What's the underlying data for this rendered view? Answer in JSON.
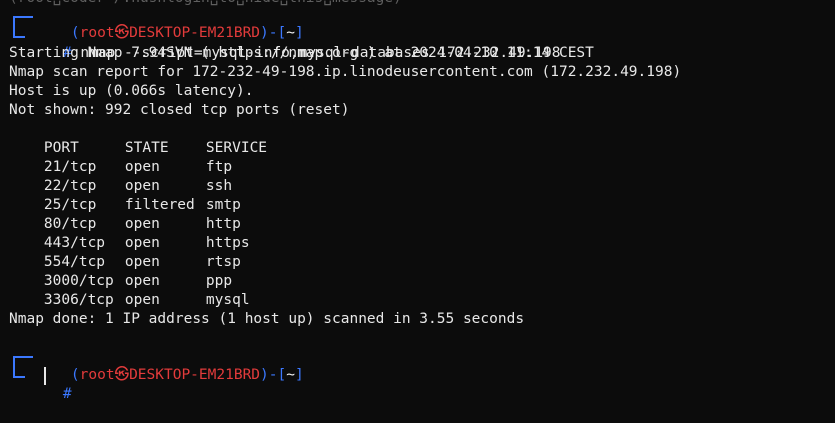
{
  "terminal": {
    "faint_top": "(root␣coder~/.hushlogin␣to␣hide␣this␣message)",
    "prompt1": {
      "open": "(",
      "user": "root",
      "sep": "㉿",
      "host": "DESKTOP-EM21BRD",
      "close": ")-[",
      "dir": "~",
      "end": "]"
    },
    "command": {
      "hash": "#",
      "text": " nmap --script=mysql-info,mysql-databases 172.232.49.198"
    },
    "output_lines": [
      "Starting Nmap 7.94SVN ( https://nmap.org ) at 2024-04-10 11:14 CEST",
      "Nmap scan report for 172-232-49-198.ip.linodeusercontent.com (172.232.49.198)",
      "Host is up (0.066s latency).",
      "Not shown: 992 closed tcp ports (reset)"
    ],
    "table": {
      "headers": [
        "PORT",
        "STATE",
        "SERVICE"
      ],
      "rows": [
        [
          "21/tcp",
          "open",
          "ftp"
        ],
        [
          "22/tcp",
          "open",
          "ssh"
        ],
        [
          "25/tcp",
          "filtered",
          "smtp"
        ],
        [
          "80/tcp",
          "open",
          "http"
        ],
        [
          "443/tcp",
          "open",
          "https"
        ],
        [
          "554/tcp",
          "open",
          "rtsp"
        ],
        [
          "3000/tcp",
          "open",
          "ppp"
        ],
        [
          "3306/tcp",
          "open",
          "mysql"
        ]
      ]
    },
    "done_line": "Nmap done: 1 IP address (1 host up) scanned in 3.55 seconds",
    "prompt2": {
      "open": "(",
      "user": "root",
      "sep": "㉿",
      "host": "DESKTOP-EM21BRD",
      "close": ")-[",
      "dir": "~",
      "end": "]"
    },
    "prompt2_hash": "#",
    "colors": {
      "background": "#0c0c0c",
      "text": "#e8e8e8",
      "prompt_blue": "#3b78ff",
      "prompt_red": "#e23b3b"
    }
  }
}
